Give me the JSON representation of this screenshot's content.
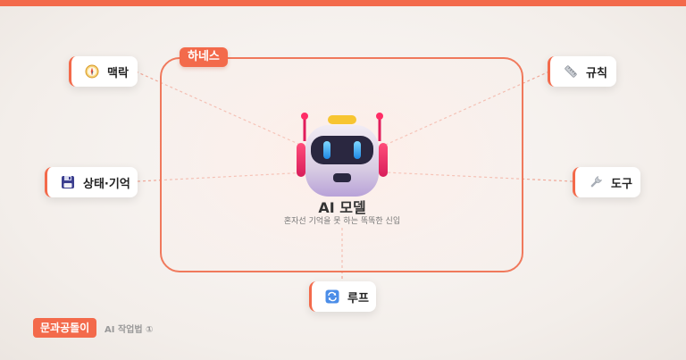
{
  "harness_label": "하네스",
  "center": {
    "title": "AI 모델",
    "subtitle": "혼자선 기억을 못 하는 똑똑한 신입"
  },
  "cards": {
    "context": "맥락",
    "rules": "규칙",
    "state_memory": "상태·기억",
    "tools": "도구",
    "loop": "루프"
  },
  "footer": {
    "brand": "문과공돌이",
    "series": "AI 작업법 ①"
  },
  "colors": {
    "accent": "#f36a4b",
    "line": "#f0a898"
  }
}
